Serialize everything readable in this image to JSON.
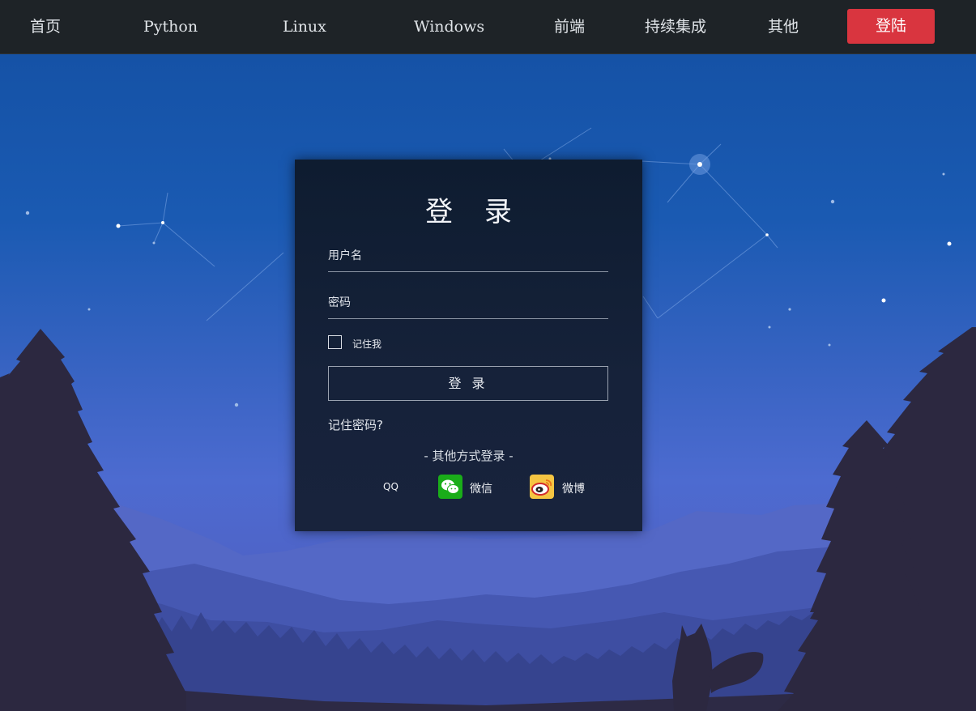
{
  "nav": {
    "items": [
      {
        "label": "首页"
      },
      {
        "label": "Python"
      },
      {
        "label": "Linux"
      },
      {
        "label": "Windows"
      },
      {
        "label": "前端"
      },
      {
        "label": "持续集成"
      },
      {
        "label": "其他"
      }
    ],
    "login_label": "登陆",
    "login_color": "#d9353f"
  },
  "login_form": {
    "title": "登 录",
    "username_placeholder": "用户名",
    "password_placeholder": "密码",
    "remember_label": "记住我",
    "submit_label": "登 录",
    "forgot_label": "记住密码?",
    "other_login_label": "- 其他方式登录 -",
    "social": [
      {
        "label": "QQ",
        "icon": "qq-icon"
      },
      {
        "label": "微信",
        "icon": "wechat-icon",
        "color": "#1aad19"
      },
      {
        "label": "微博",
        "icon": "weibo-icon",
        "color": "#f5a623"
      }
    ]
  },
  "colors": {
    "navbar_bg": "#1e2327",
    "card_bg": "#0e1c30",
    "sky_top": "#1552a6",
    "tree": "#2c2840"
  }
}
